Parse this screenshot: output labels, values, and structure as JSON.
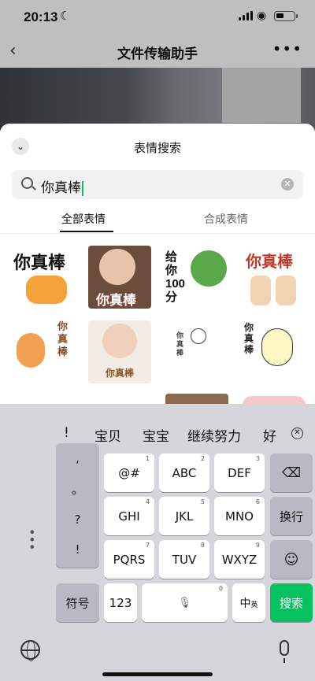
{
  "status": {
    "time": "20:13"
  },
  "nav": {
    "title": "文件传输助手"
  },
  "sheet": {
    "title": "表情搜索",
    "search_value": "你真棒",
    "tabs": [
      {
        "label": "全部表情"
      },
      {
        "label": "合成表情"
      }
    ]
  },
  "stickers": [
    {
      "text": "你真棒",
      "color": "#111"
    },
    {
      "text": "你真棒",
      "color": "#fff"
    },
    {
      "text": "给你100分",
      "color": "#111"
    },
    {
      "text": "你真棒",
      "color": "#c0392b"
    },
    {
      "text": "你真棒",
      "color": "#8a4a2a"
    },
    {
      "text": "你真棒",
      "color": "#8a5a2a"
    },
    {
      "text": "你真棒",
      "color": "#444"
    },
    {
      "text": "你真棒",
      "color": "#222"
    }
  ],
  "keyboard": {
    "candidates": [
      "!",
      "宝贝",
      "宝宝",
      "继续努力",
      "好"
    ],
    "punct": [
      ",",
      "。",
      "?",
      "!"
    ],
    "rows": [
      [
        {
          "num": "1",
          "label": "@#"
        },
        {
          "num": "2",
          "label": "ABC"
        },
        {
          "num": "3",
          "label": "DEF"
        }
      ],
      [
        {
          "num": "4",
          "label": "GHI"
        },
        {
          "num": "5",
          "label": "JKL"
        },
        {
          "num": "6",
          "label": "MNO"
        }
      ],
      [
        {
          "num": "7",
          "label": "PQRS"
        },
        {
          "num": "8",
          "label": "TUV"
        },
        {
          "num": "9",
          "label": "WXYZ"
        }
      ]
    ],
    "symbols_label": "符号",
    "num_label": "123",
    "space_num": "0",
    "lang_label": "中",
    "lang_sub": "英",
    "newline_label": "换行",
    "search_label": "搜索"
  },
  "colors": {
    "accent": "#07c160"
  }
}
